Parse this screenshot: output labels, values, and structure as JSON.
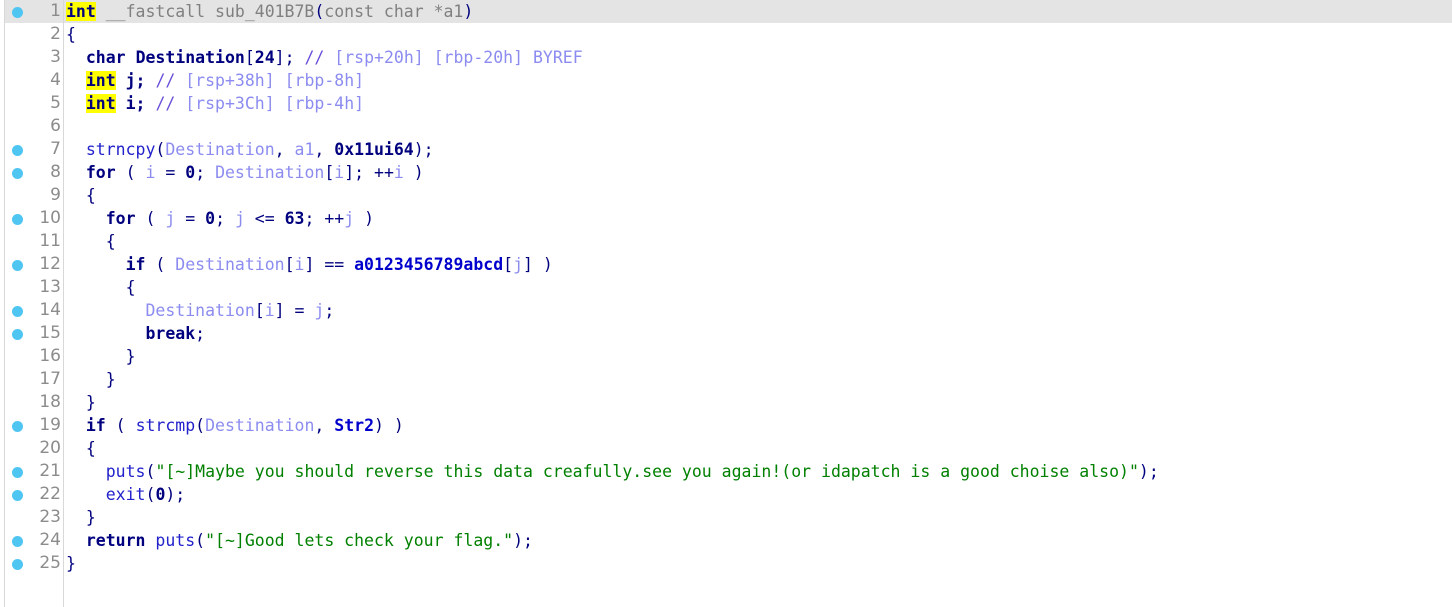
{
  "view": {
    "name": "pseudocode-view",
    "title": "Pseudocode-A",
    "function_name": "sub_401B7B",
    "total_lines": 25
  },
  "colors": {
    "background": "#ffffff",
    "current_line_highlight": "#e4e4e4",
    "keyword_highlight": "#ffff00",
    "breakpoint_dot": "#4fc6f2",
    "line_number": "#8c8c8c",
    "keyword": "#00007f",
    "local_variable": "#8c8cf0",
    "function_call": "#2222cc",
    "global_name": "#0000cc",
    "number": "#00007f",
    "comment": "#8c8cf0",
    "string_literal": "#008000",
    "dimmed_text": "#808080",
    "gutter_divider": "#d8d8d8"
  },
  "lines": [
    {
      "number": "1",
      "breakpoint": true,
      "current": true,
      "tokens": [
        {
          "text": "int",
          "cls": "t-kw-hl"
        },
        {
          "text": " __fastcall sub_401B7B",
          "cls": "t-dimmed"
        },
        {
          "text": "(",
          "cls": "t-paren"
        },
        {
          "text": "const char *a1",
          "cls": "t-dimmed"
        },
        {
          "text": ")",
          "cls": "t-paren"
        }
      ]
    },
    {
      "number": "2",
      "breakpoint": false,
      "current": false,
      "tokens": [
        {
          "text": "{",
          "cls": "t-punct"
        }
      ]
    },
    {
      "number": "3",
      "breakpoint": false,
      "current": false,
      "tokens": [
        {
          "text": "  ",
          "cls": "t-plain"
        },
        {
          "text": "char",
          "cls": "t-kw"
        },
        {
          "text": " ",
          "cls": "t-plain"
        },
        {
          "text": "Destination",
          "cls": "t-kw"
        },
        {
          "text": "[",
          "cls": "t-punct"
        },
        {
          "text": "24",
          "cls": "t-number"
        },
        {
          "text": "]; ",
          "cls": "t-punct"
        },
        {
          "text": "//",
          "cls": "t-cmark"
        },
        {
          "text": " [rsp+20h] [rbp-20h] BYREF",
          "cls": "t-comment"
        }
      ]
    },
    {
      "number": "4",
      "breakpoint": false,
      "current": false,
      "tokens": [
        {
          "text": "  ",
          "cls": "t-plain"
        },
        {
          "text": "int",
          "cls": "t-kw-hl"
        },
        {
          "text": " j; ",
          "cls": "t-kw"
        },
        {
          "text": "//",
          "cls": "t-cmark"
        },
        {
          "text": " [rsp+38h] [rbp-8h]",
          "cls": "t-comment"
        }
      ]
    },
    {
      "number": "5",
      "breakpoint": false,
      "current": false,
      "tokens": [
        {
          "text": "  ",
          "cls": "t-plain"
        },
        {
          "text": "int",
          "cls": "t-kw-hl"
        },
        {
          "text": " i; ",
          "cls": "t-kw"
        },
        {
          "text": "//",
          "cls": "t-cmark"
        },
        {
          "text": " [rsp+3Ch] [rbp-4h]",
          "cls": "t-comment"
        }
      ]
    },
    {
      "number": "6",
      "breakpoint": false,
      "current": false,
      "tokens": [
        {
          "text": "",
          "cls": "t-plain"
        }
      ]
    },
    {
      "number": "7",
      "breakpoint": true,
      "current": false,
      "tokens": [
        {
          "text": "  ",
          "cls": "t-plain"
        },
        {
          "text": "strncpy",
          "cls": "t-func"
        },
        {
          "text": "(",
          "cls": "t-punct"
        },
        {
          "text": "Destination",
          "cls": "t-local"
        },
        {
          "text": ", ",
          "cls": "t-punct"
        },
        {
          "text": "a1",
          "cls": "t-local"
        },
        {
          "text": ", ",
          "cls": "t-punct"
        },
        {
          "text": "0x11ui64",
          "cls": "t-number"
        },
        {
          "text": ");",
          "cls": "t-punct"
        }
      ]
    },
    {
      "number": "8",
      "breakpoint": true,
      "current": false,
      "tokens": [
        {
          "text": "  ",
          "cls": "t-plain"
        },
        {
          "text": "for",
          "cls": "t-kw"
        },
        {
          "text": " ( ",
          "cls": "t-punct"
        },
        {
          "text": "i",
          "cls": "t-local"
        },
        {
          "text": " = ",
          "cls": "t-punct"
        },
        {
          "text": "0",
          "cls": "t-number"
        },
        {
          "text": "; ",
          "cls": "t-punct"
        },
        {
          "text": "Destination",
          "cls": "t-local"
        },
        {
          "text": "[",
          "cls": "t-punct"
        },
        {
          "text": "i",
          "cls": "t-local"
        },
        {
          "text": "]; ++",
          "cls": "t-punct"
        },
        {
          "text": "i",
          "cls": "t-local"
        },
        {
          "text": " )",
          "cls": "t-punct"
        }
      ]
    },
    {
      "number": "9",
      "breakpoint": false,
      "current": false,
      "tokens": [
        {
          "text": "  {",
          "cls": "t-punct"
        }
      ]
    },
    {
      "number": "10",
      "breakpoint": true,
      "current": false,
      "tokens": [
        {
          "text": "    ",
          "cls": "t-plain"
        },
        {
          "text": "for",
          "cls": "t-kw"
        },
        {
          "text": " ( ",
          "cls": "t-punct"
        },
        {
          "text": "j",
          "cls": "t-local"
        },
        {
          "text": " = ",
          "cls": "t-punct"
        },
        {
          "text": "0",
          "cls": "t-number"
        },
        {
          "text": "; ",
          "cls": "t-punct"
        },
        {
          "text": "j",
          "cls": "t-local"
        },
        {
          "text": " <= ",
          "cls": "t-punct"
        },
        {
          "text": "63",
          "cls": "t-number"
        },
        {
          "text": "; ++",
          "cls": "t-punct"
        },
        {
          "text": "j",
          "cls": "t-local"
        },
        {
          "text": " )",
          "cls": "t-punct"
        }
      ]
    },
    {
      "number": "11",
      "breakpoint": false,
      "current": false,
      "tokens": [
        {
          "text": "    {",
          "cls": "t-punct"
        }
      ]
    },
    {
      "number": "12",
      "breakpoint": true,
      "current": false,
      "tokens": [
        {
          "text": "      ",
          "cls": "t-plain"
        },
        {
          "text": "if",
          "cls": "t-kw"
        },
        {
          "text": " ( ",
          "cls": "t-punct"
        },
        {
          "text": "Destination",
          "cls": "t-local"
        },
        {
          "text": "[",
          "cls": "t-punct"
        },
        {
          "text": "i",
          "cls": "t-local"
        },
        {
          "text": "] == ",
          "cls": "t-punct"
        },
        {
          "text": "a0123456789abcd",
          "cls": "t-global"
        },
        {
          "text": "[",
          "cls": "t-punct"
        },
        {
          "text": "j",
          "cls": "t-local"
        },
        {
          "text": "] )",
          "cls": "t-punct"
        }
      ]
    },
    {
      "number": "13",
      "breakpoint": false,
      "current": false,
      "tokens": [
        {
          "text": "      {",
          "cls": "t-punct"
        }
      ]
    },
    {
      "number": "14",
      "breakpoint": true,
      "current": false,
      "tokens": [
        {
          "text": "        ",
          "cls": "t-plain"
        },
        {
          "text": "Destination",
          "cls": "t-local"
        },
        {
          "text": "[",
          "cls": "t-punct"
        },
        {
          "text": "i",
          "cls": "t-local"
        },
        {
          "text": "] = ",
          "cls": "t-punct"
        },
        {
          "text": "j",
          "cls": "t-local"
        },
        {
          "text": ";",
          "cls": "t-punct"
        }
      ]
    },
    {
      "number": "15",
      "breakpoint": true,
      "current": false,
      "tokens": [
        {
          "text": "        ",
          "cls": "t-plain"
        },
        {
          "text": "break",
          "cls": "t-kw"
        },
        {
          "text": ";",
          "cls": "t-punct"
        }
      ]
    },
    {
      "number": "16",
      "breakpoint": false,
      "current": false,
      "tokens": [
        {
          "text": "      }",
          "cls": "t-punct"
        }
      ]
    },
    {
      "number": "17",
      "breakpoint": false,
      "current": false,
      "tokens": [
        {
          "text": "    }",
          "cls": "t-punct"
        }
      ]
    },
    {
      "number": "18",
      "breakpoint": false,
      "current": false,
      "tokens": [
        {
          "text": "  }",
          "cls": "t-punct"
        }
      ]
    },
    {
      "number": "19",
      "breakpoint": true,
      "current": false,
      "tokens": [
        {
          "text": "  ",
          "cls": "t-plain"
        },
        {
          "text": "if",
          "cls": "t-kw"
        },
        {
          "text": " ( ",
          "cls": "t-punct"
        },
        {
          "text": "strcmp",
          "cls": "t-func"
        },
        {
          "text": "(",
          "cls": "t-punct"
        },
        {
          "text": "Destination",
          "cls": "t-local"
        },
        {
          "text": ", ",
          "cls": "t-punct"
        },
        {
          "text": "Str2",
          "cls": "t-global"
        },
        {
          "text": ") )",
          "cls": "t-punct"
        }
      ]
    },
    {
      "number": "20",
      "breakpoint": false,
      "current": false,
      "tokens": [
        {
          "text": "  {",
          "cls": "t-punct"
        }
      ]
    },
    {
      "number": "21",
      "breakpoint": true,
      "current": false,
      "tokens": [
        {
          "text": "    ",
          "cls": "t-plain"
        },
        {
          "text": "puts",
          "cls": "t-func"
        },
        {
          "text": "(",
          "cls": "t-punct"
        },
        {
          "text": "\"[~]Maybe you should reverse this data creafully.see you again!(or idapatch is a good choise also)\"",
          "cls": "t-string"
        },
        {
          "text": ");",
          "cls": "t-punct"
        }
      ]
    },
    {
      "number": "22",
      "breakpoint": true,
      "current": false,
      "tokens": [
        {
          "text": "    ",
          "cls": "t-plain"
        },
        {
          "text": "exit",
          "cls": "t-func"
        },
        {
          "text": "(",
          "cls": "t-punct"
        },
        {
          "text": "0",
          "cls": "t-number"
        },
        {
          "text": ");",
          "cls": "t-punct"
        }
      ]
    },
    {
      "number": "23",
      "breakpoint": false,
      "current": false,
      "tokens": [
        {
          "text": "  }",
          "cls": "t-punct"
        }
      ]
    },
    {
      "number": "24",
      "breakpoint": true,
      "current": false,
      "tokens": [
        {
          "text": "  ",
          "cls": "t-plain"
        },
        {
          "text": "return",
          "cls": "t-kw"
        },
        {
          "text": " ",
          "cls": "t-plain"
        },
        {
          "text": "puts",
          "cls": "t-func"
        },
        {
          "text": "(",
          "cls": "t-punct"
        },
        {
          "text": "\"[~]Good lets check your flag.\"",
          "cls": "t-string"
        },
        {
          "text": ");",
          "cls": "t-punct"
        }
      ]
    },
    {
      "number": "25",
      "breakpoint": true,
      "current": false,
      "tokens": [
        {
          "text": "}",
          "cls": "t-punct"
        }
      ]
    }
  ]
}
